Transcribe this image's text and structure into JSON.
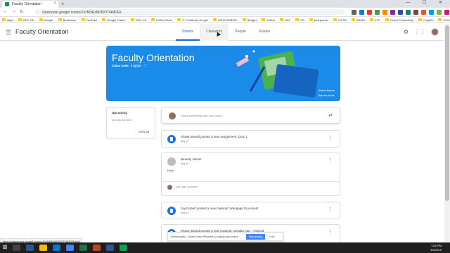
{
  "browser": {
    "tab_title": "Faculty Orientation",
    "tab_close": "×",
    "new_tab": "+",
    "window_controls": "— ☐ ✕",
    "url": "classroom.google.com/u/1/c/NDEzNDI5OTI4MDFk",
    "bookmarks": [
      "Apps",
      "DEO OK",
      "Google",
      "Bookcamp",
      "YouTube",
      "Google Trainer",
      "DEO OK",
      "EdTechTeam",
      "IT Certificate Google",
      "ASUS REBATE",
      "Badges",
      "Twitter",
      "SKC",
      "PD",
      "pearpwrxsv",
      "HSTW",
      "IDEAS",
      "KTE",
      "Chunk Productivity",
      "FrogEth",
      "OHCC"
    ]
  },
  "app": {
    "class_name": "Faculty Orientation",
    "tabs": [
      {
        "label": "Stream",
        "state": "active"
      },
      {
        "label": "Classwork",
        "state": "hover"
      },
      {
        "label": "People",
        "state": "normal"
      },
      {
        "label": "Grades",
        "state": "normal"
      }
    ]
  },
  "banner": {
    "title": "Faculty Orientation",
    "class_code_label": "Class code",
    "class_code_value": "57gfg5t",
    "select_theme": "Select theme",
    "upload_photo": "Upload photo"
  },
  "upcoming": {
    "title": "Upcoming",
    "empty": "No work due soon",
    "view_all": "View all"
  },
  "share": {
    "placeholder": "Share something with your class..."
  },
  "posts": [
    {
      "title": "Shawn Beard posted a new assignment: Quiz 1",
      "date": "Aug 14"
    },
    {
      "title": "Jay Robert posted a new material: Wengage Document",
      "date": "Aug 14"
    },
    {
      "title": "Shawn Beard posted a new material: Sendits App - Android",
      "date": ""
    }
  ],
  "announcement": {
    "author": "Beverly James",
    "date": "Aug 14",
    "body": "Hello",
    "comment_placeholder": "Add class comment..."
  },
  "screencast": {
    "text": "Screencastify - Screen Video Recorder is sharing your screen.",
    "stop": "Stop sharing",
    "hide": "Hide"
  },
  "status_url": "https://classroom.google.com/u/1/c/NDEzNDI5OTI4MDFk/t/all",
  "clock": {
    "time": "7:52 PM",
    "date": "8/4/2019"
  },
  "colors": {
    "accent": "#1967d2",
    "banner": "#1a8be8"
  }
}
